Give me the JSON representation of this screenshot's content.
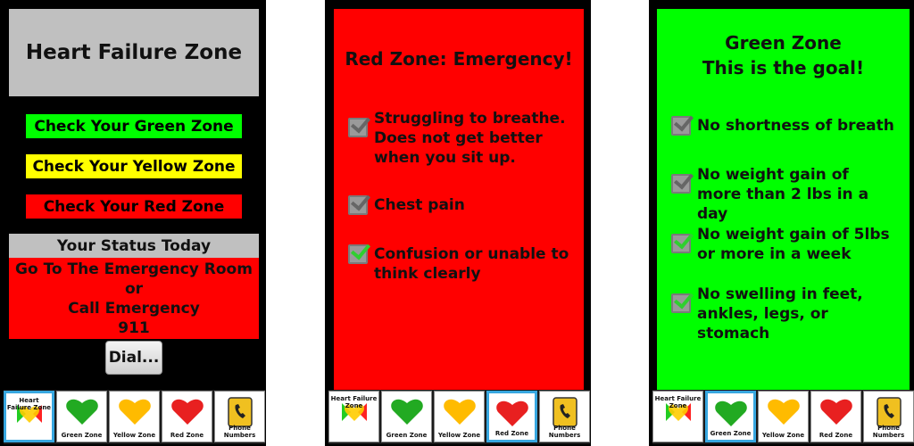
{
  "screen1": {
    "title": "Heart Failure Zone",
    "buttons": [
      {
        "label": "Check Your Green Zone",
        "color": "#00ff00"
      },
      {
        "label": "Check Your Yellow Zone",
        "color": "#ffff00"
      },
      {
        "label": "Check Your Red Zone",
        "color": "#ff0000"
      }
    ],
    "status_header": "Your Status Today",
    "status_lines": [
      "Go To The Emergency Room",
      "or",
      "Call Emergency",
      "911"
    ],
    "dial_label": "Dial..."
  },
  "screen2": {
    "title": "Red Zone: Emergency!",
    "bg": "#ff0000",
    "items": [
      {
        "text": "Struggling to breathe. Does not get better when you sit up.",
        "checked": false
      },
      {
        "text": "Chest pain",
        "checked": false
      },
      {
        "text": "Confusion or unable to think clearly",
        "checked": true
      }
    ]
  },
  "screen3": {
    "title_line1": "Green Zone",
    "title_line2": "This is the goal!",
    "bg": "#00ff00",
    "items": [
      {
        "text": "No shortness of breath",
        "checked": false
      },
      {
        "text": "No weight gain of more than 2 lbs in a day",
        "checked": false
      },
      {
        "text": "No weight gain of 5lbs or more in a week",
        "checked": true
      },
      {
        "text": "No swelling in feet, ankles, legs, or stomach",
        "checked": true
      }
    ]
  },
  "tabs": [
    {
      "label": "Heart Failure Zone",
      "icon": "heart-failure-zone-icon"
    },
    {
      "label": "Green Zone",
      "icon": "green-heart-icon"
    },
    {
      "label": "Yellow Zone",
      "icon": "yellow-heart-icon"
    },
    {
      "label": "Red Zone",
      "icon": "red-heart-icon"
    },
    {
      "label": "Phone Numbers",
      "icon": "phone-book-icon"
    }
  ]
}
